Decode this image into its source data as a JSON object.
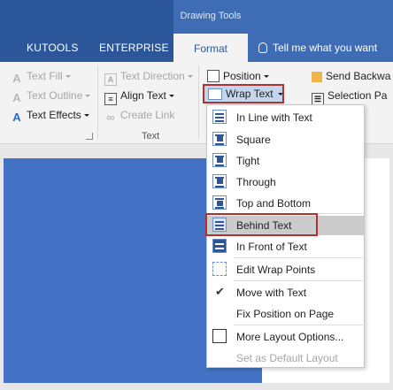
{
  "title": {
    "context": "Drawing Tools"
  },
  "tabs": [
    {
      "label": "KUTOOLS"
    },
    {
      "label": "ENTERPRISE"
    },
    {
      "label": "Format"
    }
  ],
  "tellme": "Tell me what you want",
  "ribbon": {
    "text_fill": "Text Fill",
    "text_outline": "Text Outline",
    "text_effects": "Text Effects",
    "text_direction": "Text Direction",
    "align_text": "Align Text",
    "create_link": "Create Link",
    "group_text": "Text",
    "position": "Position",
    "wrap_text": "Wrap Text",
    "send_backward": "Send Backwa",
    "selection_pane": "Selection Pa"
  },
  "wrap_menu": {
    "items": [
      {
        "label": "In Line with Text",
        "icon": "inline-icon"
      },
      {
        "label": "Square",
        "icon": "square-wrap-icon"
      },
      {
        "label": "Tight",
        "icon": "tight-wrap-icon"
      },
      {
        "label": "Through",
        "icon": "through-wrap-icon"
      },
      {
        "label": "Top and Bottom",
        "icon": "top-bottom-wrap-icon"
      },
      {
        "label": "Behind Text",
        "icon": "behind-text-icon"
      },
      {
        "label": "In Front of Text",
        "icon": "in-front-text-icon"
      },
      {
        "label": "Edit Wrap Points",
        "icon": "edit-wrap-points-icon"
      },
      {
        "label": "Move with Text",
        "icon": "check-icon"
      },
      {
        "label": "Fix Position on Page",
        "icon": ""
      },
      {
        "label": "More Layout Options...",
        "icon": "layout-options-icon"
      },
      {
        "label": "Set as Default Layout",
        "icon": ""
      }
    ],
    "highlighted": "Behind Text",
    "checked": "Move with Text"
  },
  "colors": {
    "brand": "#2b579a",
    "highlight_border": "#b0312f",
    "shape_fill": "#4472c4"
  }
}
